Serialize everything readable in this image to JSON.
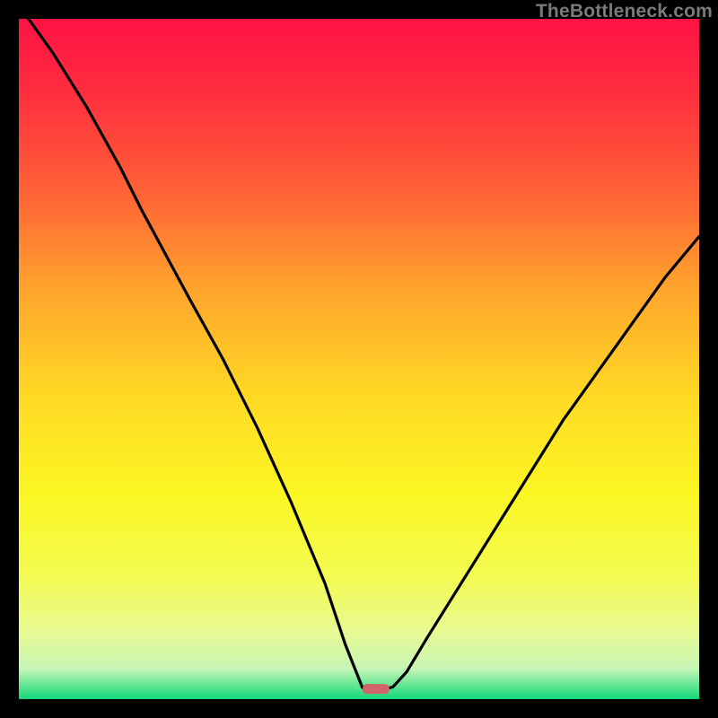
{
  "watermark": "TheBottleneck.com",
  "chart_data": {
    "type": "line",
    "title": "",
    "xlabel": "",
    "ylabel": "",
    "x_range": [
      0,
      100
    ],
    "y_range": [
      0,
      100
    ],
    "optimum_x": 53,
    "marker": {
      "x": 52.5,
      "y": 1.5,
      "color": "#d1646b"
    },
    "series": [
      {
        "name": "bottleneck-curve",
        "points": [
          {
            "x": 0,
            "y": 102
          },
          {
            "x": 5,
            "y": 95
          },
          {
            "x": 10,
            "y": 87
          },
          {
            "x": 15,
            "y": 78
          },
          {
            "x": 18,
            "y": 72
          },
          {
            "x": 25,
            "y": 59
          },
          {
            "x": 30,
            "y": 50
          },
          {
            "x": 35,
            "y": 40
          },
          {
            "x": 40,
            "y": 29
          },
          {
            "x": 45,
            "y": 17
          },
          {
            "x": 48,
            "y": 8
          },
          {
            "x": 50.5,
            "y": 1.7
          },
          {
            "x": 52,
            "y": 1.4
          },
          {
            "x": 53.5,
            "y": 1.4
          },
          {
            "x": 55,
            "y": 1.8
          },
          {
            "x": 57,
            "y": 4
          },
          {
            "x": 60,
            "y": 9
          },
          {
            "x": 65,
            "y": 17
          },
          {
            "x": 70,
            "y": 25
          },
          {
            "x": 75,
            "y": 33
          },
          {
            "x": 80,
            "y": 41
          },
          {
            "x": 85,
            "y": 48
          },
          {
            "x": 90,
            "y": 55
          },
          {
            "x": 95,
            "y": 62
          },
          {
            "x": 100,
            "y": 68
          }
        ]
      }
    ],
    "gradient_stops": [
      {
        "offset": 0.0,
        "color": "#ff1345"
      },
      {
        "offset": 0.1,
        "color": "#ff2b3f"
      },
      {
        "offset": 0.25,
        "color": "#ff6037"
      },
      {
        "offset": 0.4,
        "color": "#ffa52c"
      },
      {
        "offset": 0.55,
        "color": "#ffd824"
      },
      {
        "offset": 0.7,
        "color": "#fbf723"
      },
      {
        "offset": 0.82,
        "color": "#f3fb52"
      },
      {
        "offset": 0.9,
        "color": "#e8fa92"
      },
      {
        "offset": 0.955,
        "color": "#c7f6b6"
      },
      {
        "offset": 0.985,
        "color": "#4fe28c"
      },
      {
        "offset": 1.0,
        "color": "#11d77b"
      }
    ]
  }
}
